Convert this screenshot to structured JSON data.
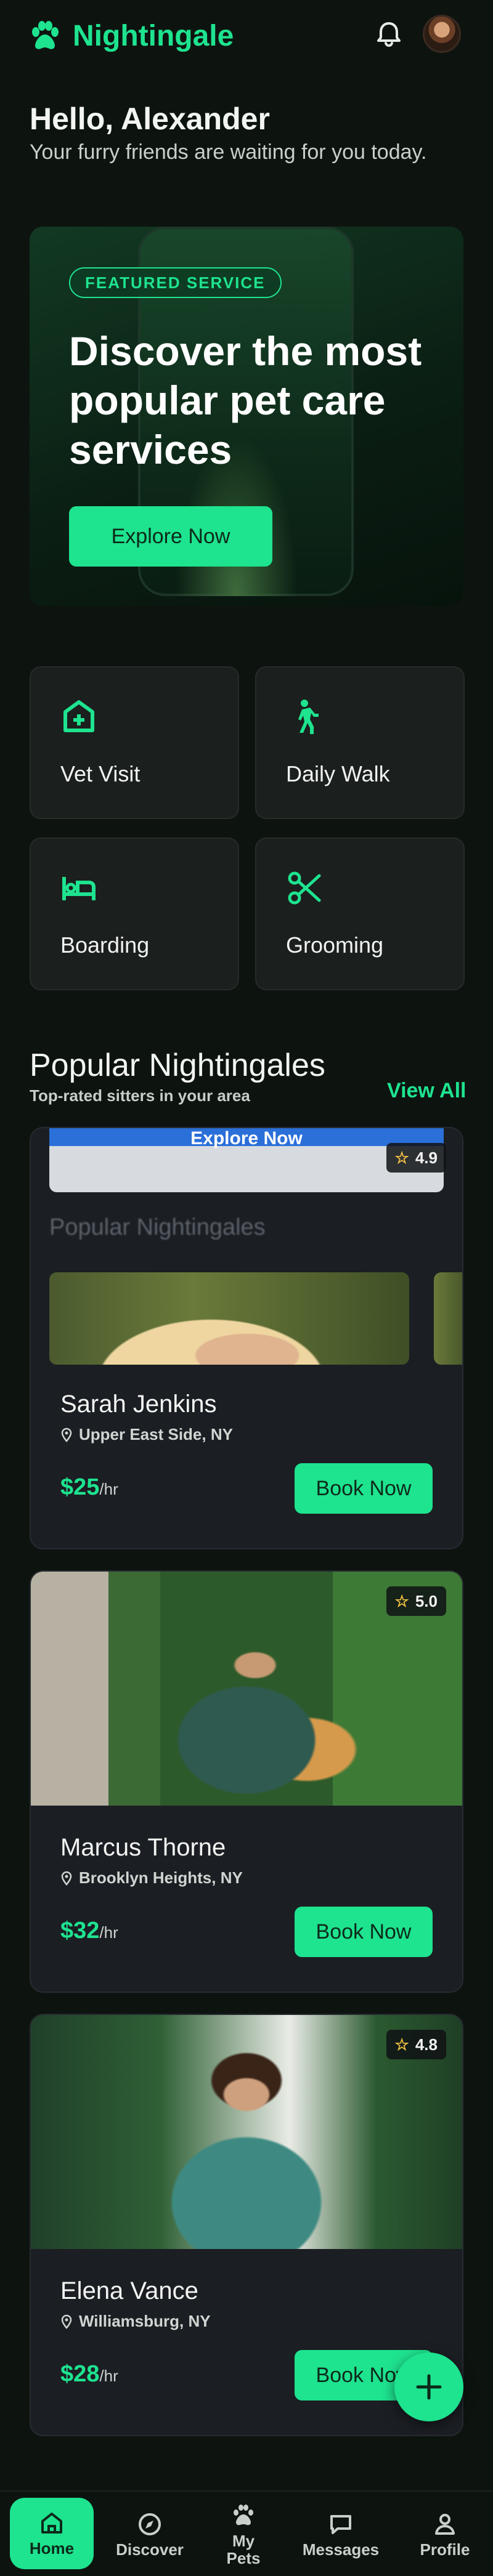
{
  "header": {
    "brand": "Nightingale"
  },
  "greeting": {
    "title": "Hello, Alexander",
    "subtitle": "Your furry friends are waiting for you today."
  },
  "hero": {
    "badge": "FEATURED SERVICE",
    "title": "Discover the most popular pet care services",
    "button": "Explore Now"
  },
  "services": [
    {
      "label": "Vet Visit",
      "icon": "medical-bag-icon"
    },
    {
      "label": "Daily Walk",
      "icon": "walking-person-icon"
    },
    {
      "label": "Boarding",
      "icon": "bed-icon"
    },
    {
      "label": "Grooming",
      "icon": "scissors-icon"
    }
  ],
  "popular": {
    "title": "Popular Nightingales",
    "subtitle": "Top-rated sitters in your area",
    "view_all": "View All"
  },
  "card1_preview": {
    "bar_text": "Explore Now",
    "section_title": "Popular Nightingales"
  },
  "sitters": [
    {
      "name": "Sarah Jenkins",
      "location": "Upper East Side, NY",
      "price": "$25",
      "unit": "/hr",
      "rating": "4.9",
      "button": "Book Now"
    },
    {
      "name": "Marcus Thorne",
      "location": "Brooklyn Heights, NY",
      "price": "$32",
      "unit": "/hr",
      "rating": "5.0",
      "button": "Book Now"
    },
    {
      "name": "Elena Vance",
      "location": "Williamsburg, NY",
      "price": "$28",
      "unit": "/hr",
      "rating": "4.8",
      "button": "Book Now"
    }
  ],
  "nav": {
    "home": "Home",
    "discover": "Discover",
    "pets": "My Pets",
    "messages": "Messages",
    "profile": "Profile"
  },
  "colors": {
    "accent": "#1ee38f",
    "background": "#0d1410",
    "card": "#1b1e23",
    "star": "#f5c542"
  }
}
